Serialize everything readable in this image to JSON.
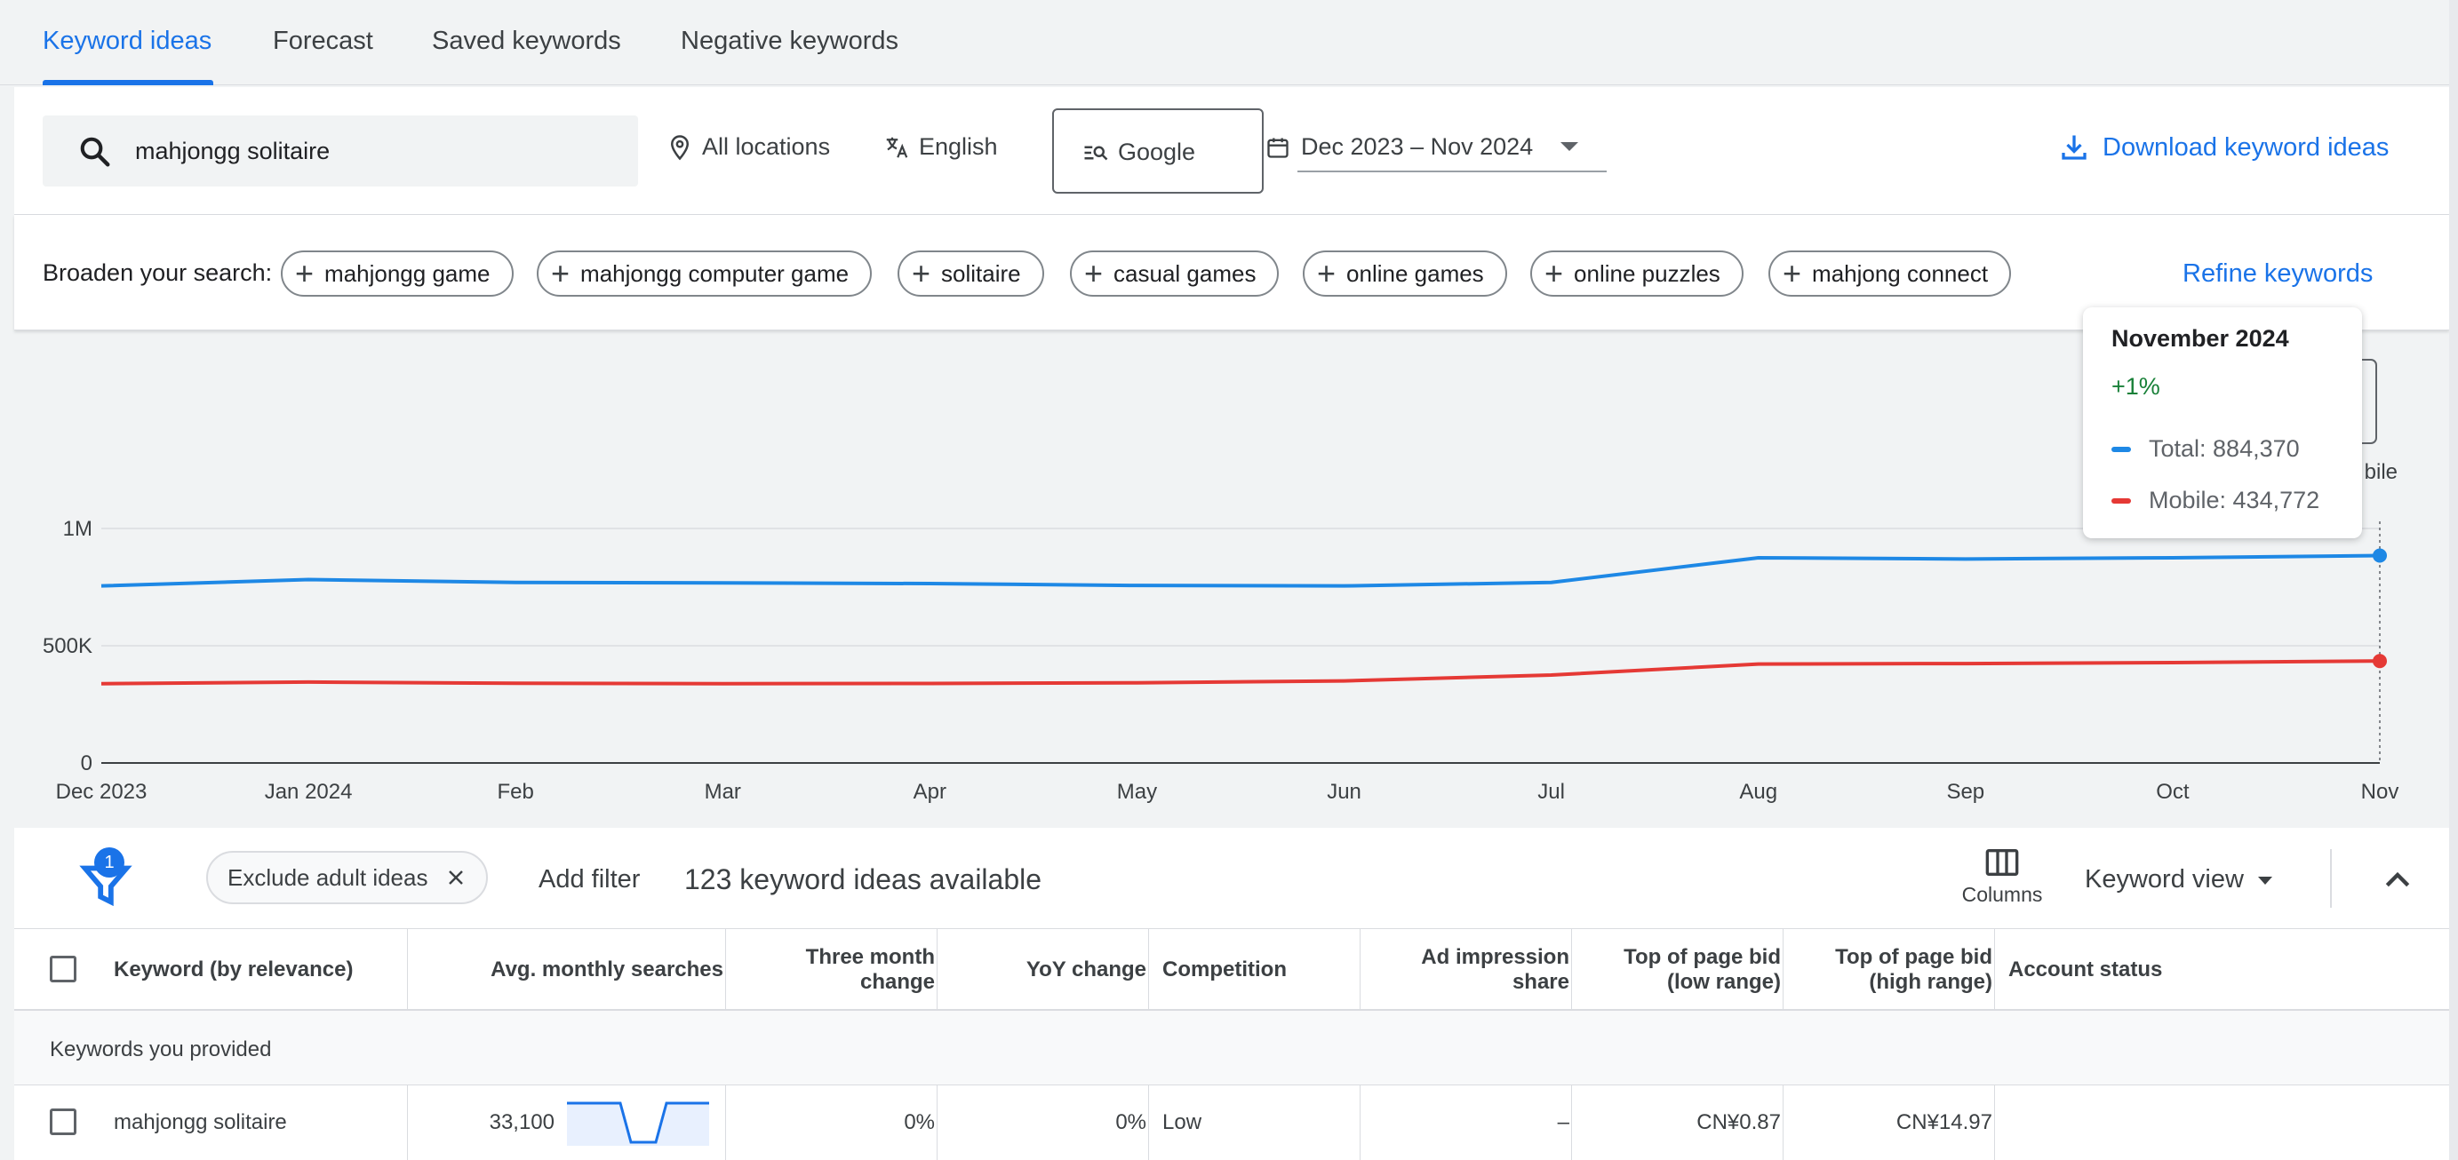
{
  "tabs": [
    {
      "label": "Keyword ideas",
      "active": true
    },
    {
      "label": "Forecast"
    },
    {
      "label": "Saved keywords"
    },
    {
      "label": "Negative keywords"
    }
  ],
  "search": {
    "query": "mahjongg solitaire",
    "location": "All locations",
    "language": "English",
    "engine": "Google",
    "date_range": "Dec 2023 – Nov 2024",
    "download_label": "Download keyword ideas"
  },
  "broaden": {
    "label": "Broaden your search:",
    "chips": [
      "mahjongg game",
      "mahjongg computer game",
      "solitaire",
      "casual games",
      "online games",
      "online puzzles",
      "mahjong connect"
    ],
    "refine_label": "Refine keywords"
  },
  "legend_fragment": "bile",
  "tooltip": {
    "title": "November 2024",
    "change": "+1%",
    "total": "Total: 884,370",
    "mobile": "Mobile: 434,772"
  },
  "chart_data": {
    "type": "line",
    "categories": [
      "Dec 2023",
      "Jan 2024",
      "Feb",
      "Mar",
      "Apr",
      "May",
      "Jun",
      "Jul",
      "Aug",
      "Sep",
      "Oct",
      "Nov"
    ],
    "series": [
      {
        "name": "Total",
        "color": "#1e88e5",
        "values": [
          755000,
          782000,
          770000,
          768000,
          765000,
          757000,
          755000,
          770000,
          875000,
          870000,
          875000,
          884370
        ]
      },
      {
        "name": "Mobile",
        "color": "#e53935",
        "values": [
          338000,
          345000,
          340000,
          338000,
          339000,
          342000,
          350000,
          375000,
          422000,
          424000,
          428000,
          434772
        ]
      }
    ],
    "y_ticks": [
      "0",
      "500K",
      "1M"
    ],
    "ylim": [
      0,
      1000000
    ],
    "grid": true,
    "highlight_index": 11
  },
  "filter": {
    "badge": "1",
    "exclude_chip": "Exclude adult ideas",
    "add_filter": "Add filter",
    "available": "123 keyword ideas available",
    "columns_label": "Columns",
    "view_label": "Keyword view"
  },
  "table": {
    "headers": {
      "keyword": "Keyword (by relevance)",
      "avg": "Avg. monthly searches",
      "three_month_1": "Three month",
      "three_month_2": "change",
      "yoy": "YoY change",
      "competition": "Competition",
      "ad_imp_1": "Ad impression",
      "ad_imp_2": "share",
      "bid_low_1": "Top of page bid",
      "bid_low_2": "(low range)",
      "bid_high_1": "Top of page bid",
      "bid_high_2": "(high range)",
      "status": "Account status"
    },
    "group_label": "Keywords you provided",
    "rows": [
      {
        "keyword": "mahjongg solitaire",
        "avg": "33,100",
        "three_month": "0%",
        "yoy": "0%",
        "competition": "Low",
        "ad_imp": "–",
        "bid_low": "CN¥0.87",
        "bid_high": "CN¥14.97",
        "status": ""
      }
    ]
  }
}
